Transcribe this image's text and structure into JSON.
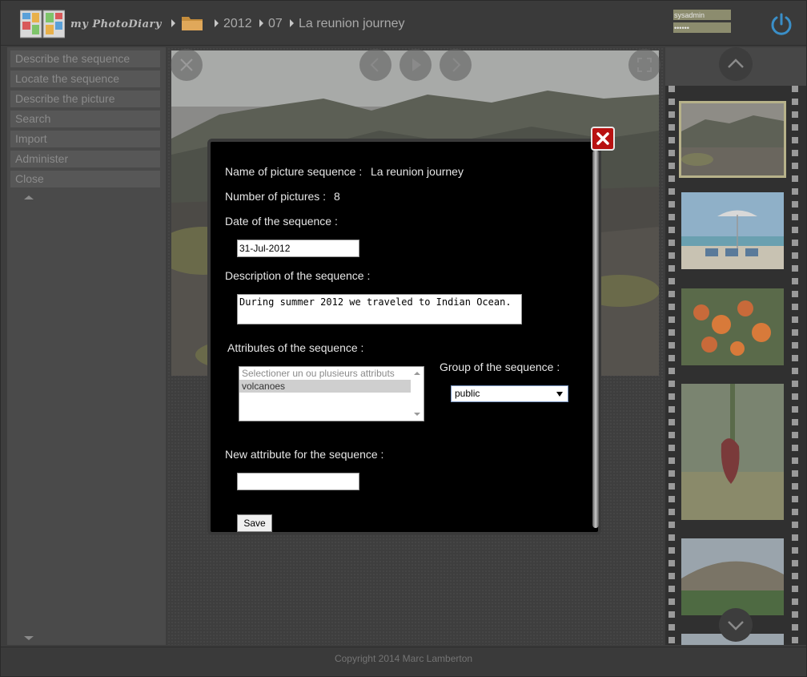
{
  "header": {
    "app_name": "my PhotoDiary",
    "breadcrumbs": [
      "2012",
      "07",
      "La reunion journey"
    ],
    "login_user": "sysadmin",
    "login_password": "••••••"
  },
  "sidebar": {
    "items": [
      {
        "label": "Describe the sequence"
      },
      {
        "label": "Locate the sequence"
      },
      {
        "label": "Describe the picture"
      },
      {
        "label": "Search"
      },
      {
        "label": "Import"
      },
      {
        "label": "Administer"
      },
      {
        "label": "Close"
      }
    ]
  },
  "modal": {
    "name_label": "Name of picture sequence :",
    "name_value": "La reunion journey",
    "count_label": "Number of pictures :",
    "count_value": "8",
    "date_label": "Date of the sequence :",
    "date_value": "31-Jul-2012",
    "description_label": "Description of the sequence :",
    "description_value": "During summer 2012 we traveled to Indian Ocean.",
    "attributes_label": "Attributes of the sequence :",
    "attributes_placeholder": "Selectioner un ou plusieurs attributs",
    "attributes_options": [
      "volcanoes"
    ],
    "group_label": "Group of the sequence :",
    "group_value": "public",
    "new_attribute_label": "New attribute for the sequence :",
    "new_attribute_value": "",
    "save_label": "Save"
  },
  "footer": {
    "copyright": "Copyright 2014 Marc Lamberton"
  },
  "colors": {
    "close_button": "#b81111",
    "selected_thumb_border": "#b7b28a",
    "modal_background": "#000000"
  }
}
